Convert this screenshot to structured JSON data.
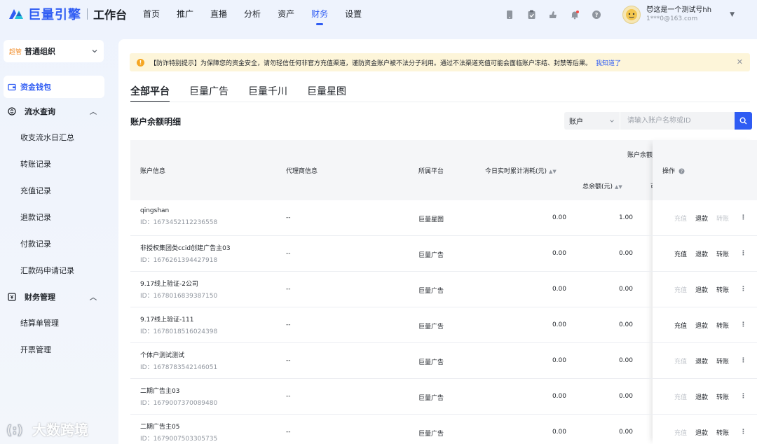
{
  "brand": {
    "name": "巨量引擎",
    "sub": "工作台"
  },
  "nav": [
    "首页",
    "推广",
    "直播",
    "分析",
    "资产",
    "财务",
    "设置"
  ],
  "nav_active": 5,
  "user": {
    "name": "😈这是一个测试号hh",
    "email": "1***0@163.com"
  },
  "org": {
    "badge": "超管",
    "name": "普通组织"
  },
  "sidebar": {
    "wallet": "资金钱包",
    "flow_group": "流水查询",
    "flow_items": [
      "收支流水日汇总",
      "转账记录",
      "充值记录",
      "退款记录",
      "付款记录",
      "汇款码申请记录"
    ],
    "finance_group": "财务管理",
    "finance_items": [
      "结算单管理",
      "开票管理"
    ]
  },
  "alert": {
    "text": "【防诈特别提示】为保障您的资金安全，请勿轻信任何非官方充值渠道，谨防资金账户被不法分子利用。通过不法渠道充值可能会面临账户冻结、封禁等后果。",
    "link": "我知道了"
  },
  "tabs": [
    "全部平台",
    "巨量广告",
    "巨量千川",
    "巨量星图"
  ],
  "section_title": "账户余额明细",
  "search": {
    "select": "账户",
    "placeholder": "请输入账户名称或ID"
  },
  "table": {
    "headers": {
      "account": "账户信息",
      "agent": "代理商信息",
      "platform": "所属平台",
      "today": "今日实时累计消耗(元)",
      "balance_group": "账户余额",
      "total": "总余额(元)",
      "avail_cut": "可",
      "ops": "操作"
    },
    "ops_labels": {
      "recharge": "充值",
      "refund": "退款",
      "transfer": "转账"
    },
    "rows": [
      {
        "name": "qingshan",
        "id": "ID：1673452112236558",
        "agent": "--",
        "platform": "巨量星图",
        "today": "0.00",
        "total": "1.00",
        "recharge_on": false,
        "refund_on": true,
        "transfer_on": false
      },
      {
        "name": "非授权集团类ccid创建广告主03",
        "id": "ID：1676261394427918",
        "agent": "--",
        "platform": "巨量广告",
        "today": "0.00",
        "total": "0.00",
        "recharge_on": true,
        "refund_on": true,
        "transfer_on": true
      },
      {
        "name": "9.17线上验证-2公司",
        "id": "ID：1678016839387150",
        "agent": "--",
        "platform": "巨量广告",
        "today": "0.00",
        "total": "0.00",
        "recharge_on": false,
        "refund_on": true,
        "transfer_on": true
      },
      {
        "name": "9.17线上验证-111",
        "id": "ID：1678018516024398",
        "agent": "--",
        "platform": "巨量广告",
        "today": "0.00",
        "total": "0.00",
        "recharge_on": true,
        "refund_on": true,
        "transfer_on": true
      },
      {
        "name": "个体户测试测试",
        "id": "ID：1678783542146051",
        "agent": "--",
        "platform": "巨量广告",
        "today": "0.00",
        "total": "0.00",
        "recharge_on": false,
        "refund_on": true,
        "transfer_on": true
      },
      {
        "name": "二期广告主03",
        "id": "ID：1679007370089480",
        "agent": "--",
        "platform": "巨量广告",
        "today": "0.00",
        "total": "0.00",
        "recharge_on": false,
        "refund_on": true,
        "transfer_on": true
      },
      {
        "name": "二期广告主05",
        "id": "ID：1679007503305735",
        "agent": "--",
        "platform": "巨量广告",
        "today": "0.00",
        "total": "0.00",
        "recharge_on": false,
        "refund_on": true,
        "transfer_on": true
      }
    ]
  },
  "watermark": "大数跨境",
  "colors": {
    "accent": "#2f5cf3",
    "alert_bg": "#fdf5d9",
    "warning": "#f5a623"
  }
}
